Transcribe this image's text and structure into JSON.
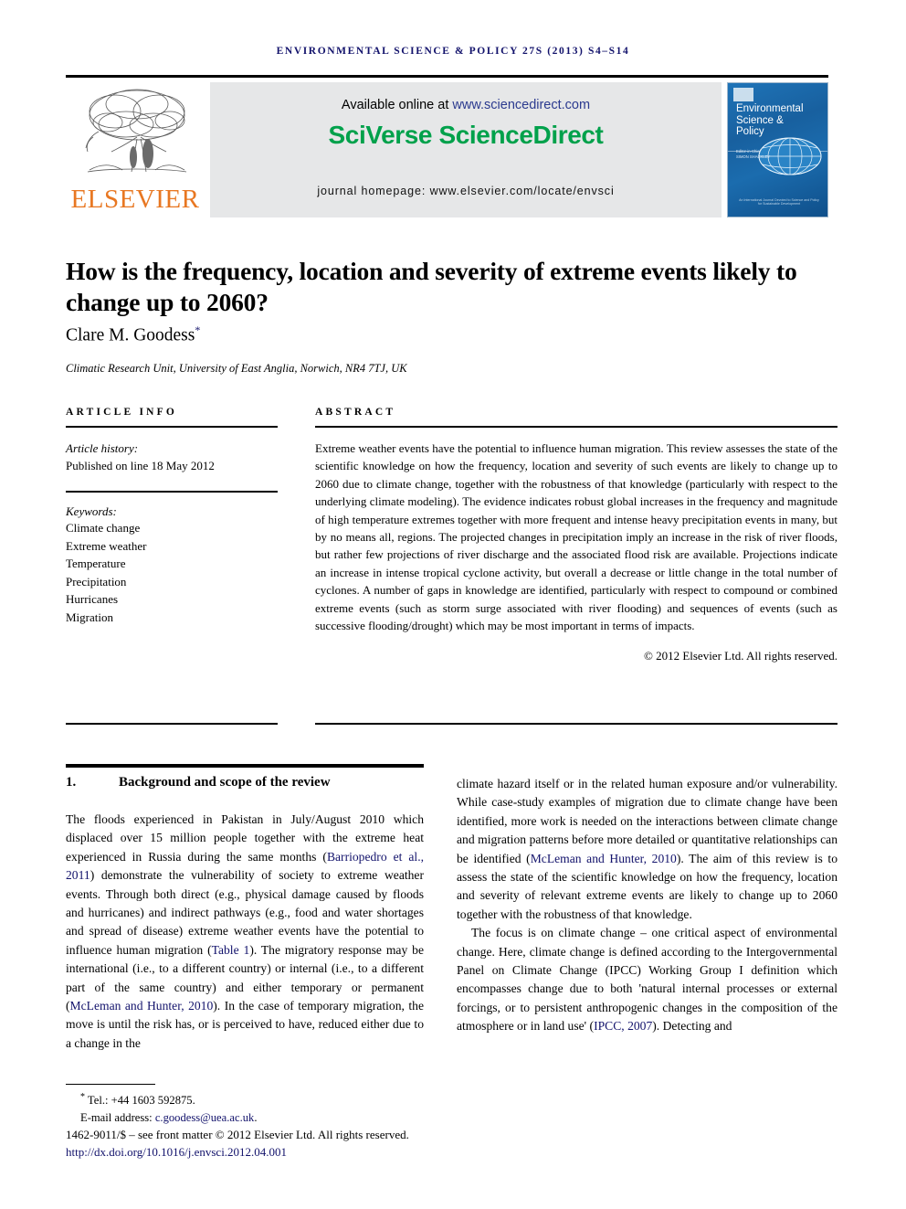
{
  "running_head": "environmental science & policy 27s (2013) s4–s14",
  "masthead": {
    "publisher_name": "ELSEVIER",
    "publisher_logo_icon": "elsevier-tree-icon",
    "available_prefix": "Available online at ",
    "available_url": "www.sciencedirect.com",
    "platform_title": "SciVerse ScienceDirect",
    "homepage_line": "journal homepage: www.elsevier.com/locate/envsci",
    "cover": {
      "title_line1": "Environmental",
      "title_line2": "Science &",
      "title_line3": "Policy",
      "editor_label": "Editor-in-Chief",
      "editor_name": "SIMON SHACKLEY",
      "globe_icon": "globe-icon",
      "footer_text": "An International Journal Devoted to Science and Policy for Sustainable Development"
    }
  },
  "article": {
    "title": "How is the frequency, location and severity of extreme events likely to change up to 2060?",
    "author": "Clare M. Goodess",
    "author_marker": "*",
    "affiliation": "Climatic Research Unit, University of East Anglia, Norwich, NR4 7TJ, UK"
  },
  "info": {
    "heading": "ARTICLE INFO",
    "history_label": "Article history:",
    "history_value": "Published on line 18 May 2012",
    "keywords_label": "Keywords:",
    "keywords": [
      "Climate change",
      "Extreme weather",
      "Temperature",
      "Precipitation",
      "Hurricanes",
      "Migration"
    ]
  },
  "abstract": {
    "heading": "ABSTRACT",
    "text": "Extreme weather events have the potential to influence human migration. This review assesses the state of the scientific knowledge on how the frequency, location and severity of such events are likely to change up to 2060 due to climate change, together with the robustness of that knowledge (particularly with respect to the underlying climate modeling). The evidence indicates robust global increases in the frequency and magnitude of high temperature extremes together with more frequent and intense heavy precipitation events in many, but by no means all, regions. The projected changes in precipitation imply an increase in the risk of river floods, but rather few projections of river discharge and the associated flood risk are available. Projections indicate an increase in intense tropical cyclone activity, but overall a decrease or little change in the total number of cyclones. A number of gaps in knowledge are identified, particularly with respect to compound or combined extreme events (such as storm surge associated with river flooding) and sequences of events (such as successive flooding/drought) which may be most important in terms of impacts.",
    "copyright": "© 2012 Elsevier Ltd. All rights reserved."
  },
  "body": {
    "section_number": "1.",
    "section_title": "Background and scope of the review",
    "left_paragraph_1": "The floods experienced in Pakistan in July/August 2010 which displaced over 15 million people together with the extreme heat experienced in Russia during the same months (Barriopedro et al., 2011) demonstrate the vulnerability of society to extreme weather events. Through both direct (e.g., physical damage caused by floods and hurricanes) and indirect pathways (e.g., food and water shortages and spread of disease) extreme weather events have the potential to influence human migration (Table 1). The migratory response may be international (i.e., to a different country) or internal (i.e., to a different part of the same country) and either temporary or permanent (McLeman and Hunter, 2010). In the case of temporary migration, the move is until the risk has, or is perceived to have, reduced either due to a change in the",
    "right_paragraph_1": "climate hazard itself or in the related human exposure and/or vulnerability. While case-study examples of migration due to climate change have been identified, more work is needed on the interactions between climate change and migration patterns before more detailed or quantitative relationships can be identified (McLeman and Hunter, 2010). The aim of this review is to assess the state of the scientific knowledge on how the frequency, location and severity of relevant extreme events are likely to change up to 2060 together with the robustness of that knowledge.",
    "right_paragraph_2": "The focus is on climate change – one critical aspect of environmental change. Here, climate change is defined according to the Intergovernmental Panel on Climate Change (IPCC) Working Group I definition which encompasses change due to both 'natural internal processes or external forcings, or to persistent anthropogenic changes in the composition of the atmosphere or in land use' (IPCC, 2007). Detecting and"
  },
  "footnotes": {
    "marker": "*",
    "tel": "Tel.: +44 1603 592875.",
    "email_label": "E-mail address: ",
    "email": "c.goodess@uea.ac.uk",
    "email_suffix": ".",
    "issn_line": "1462-9011/$ – see front matter © 2012 Elsevier Ltd. All rights reserved.",
    "doi": "http://dx.doi.org/10.1016/j.envsci.2012.04.001"
  },
  "colors": {
    "link_blue": "#12126b",
    "sciencedirect_green": "#00a14b",
    "elsevier_orange": "#e87722"
  }
}
